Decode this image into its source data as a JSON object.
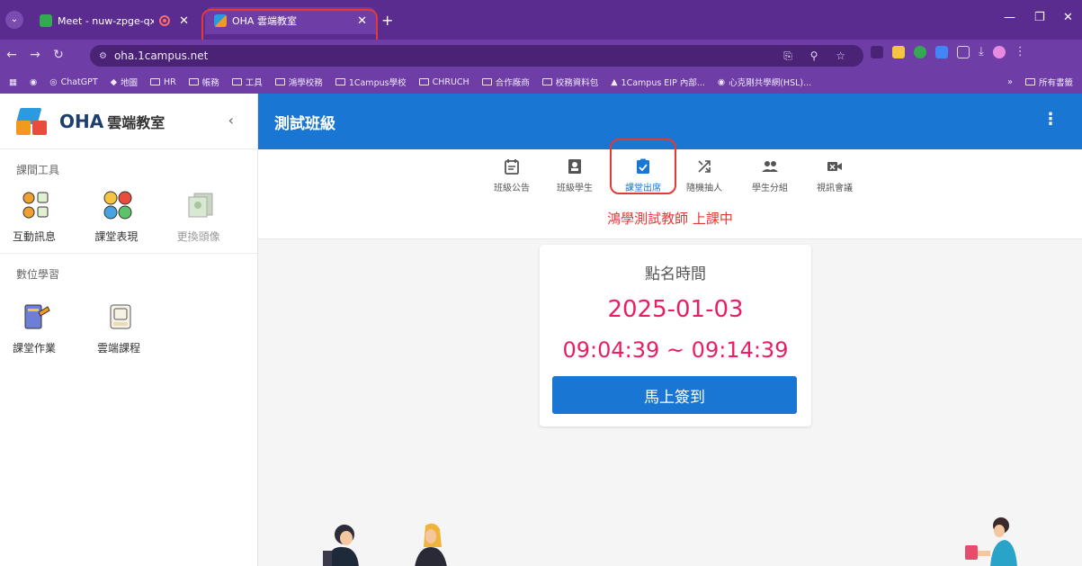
{
  "browser": {
    "tabs": [
      {
        "title": "Meet - nuw-zpge-qxd",
        "active": false
      },
      {
        "title": "OHA 雲端教室",
        "active": true
      }
    ],
    "new_tab": "+",
    "url": "oha.1campus.net",
    "bookmarks": [
      "ChatGPT",
      "地圖",
      "HR",
      "帳務",
      "工具",
      "鴻學校務",
      "1Campus學校",
      "CHRUCH",
      "合作廠商",
      "校務資料包",
      "1Campus EIP 內部...",
      "心克剛共學網(HSL)..."
    ],
    "bookmarks_all": "所有書籤",
    "bookmarks_more": "»"
  },
  "app": {
    "logo": "OHA",
    "logo_sub": "雲端教室",
    "class_title": "測試班級",
    "colors": {
      "primary": "#1976d2",
      "accent": "#e91e63",
      "alert": "#e53935"
    }
  },
  "sidebar": {
    "sections": [
      {
        "title": "課間工具",
        "items": [
          {
            "label": "互動訊息",
            "icon": "interactive-message-icon"
          },
          {
            "label": "課堂表現",
            "icon": "class-performance-icon"
          },
          {
            "label": "更換頭像",
            "icon": "change-avatar-icon",
            "disabled": true
          }
        ]
      },
      {
        "title": "數位學習",
        "items": [
          {
            "label": "課堂作業",
            "icon": "class-homework-icon"
          },
          {
            "label": "雲端課程",
            "icon": "cloud-course-icon"
          }
        ]
      }
    ]
  },
  "toolbar": {
    "items": [
      {
        "label": "班級公告",
        "icon": "announcement-icon"
      },
      {
        "label": "班級學生",
        "icon": "students-icon"
      },
      {
        "label": "課堂出席",
        "icon": "attendance-icon",
        "active": true
      },
      {
        "label": "隨機抽人",
        "icon": "shuffle-icon"
      },
      {
        "label": "學生分組",
        "icon": "group-icon"
      },
      {
        "label": "視訊會議",
        "icon": "video-conference-icon"
      }
    ],
    "status": "鴻學測試教師 上課中"
  },
  "attendance": {
    "label": "點名時間",
    "date": "2025-01-03",
    "time_range": "09:04:39 ~ 09:14:39",
    "button": "馬上簽到"
  }
}
